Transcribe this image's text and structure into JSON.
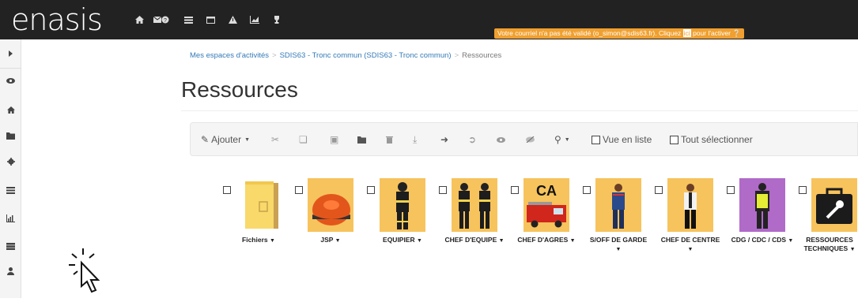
{
  "app": {
    "logo": "enasis",
    "notice": "Votre courriel n'a pas été validé (o_simon@sdis63.fr). Cliquez ",
    "notice_link": "ici",
    "notice_tail": " pour l'activer"
  },
  "topnav": {
    "icons": [
      "home-icon",
      "mail-icon",
      "messages-badge-icon",
      "list-icon",
      "window-icon",
      "warning-icon",
      "area-chart-icon",
      "trophy-icon"
    ]
  },
  "rail": {
    "icons": [
      "caret-right-icon",
      "eye-icon",
      "home-icon",
      "folder-icon",
      "gear-icon",
      "list-icon",
      "bar-chart-icon",
      "server-icon",
      "user-icon"
    ]
  },
  "breadcrumb": {
    "items": [
      "Mes espaces d'activités",
      "SDIS63 - Tronc commun (SDIS63 - Tronc commun)",
      "Ressources"
    ]
  },
  "page": {
    "title": "Ressources"
  },
  "toolbar": {
    "add_label": "Ajouter",
    "list_view_label": "Vue en liste",
    "select_all_label": "Tout sélectionner"
  },
  "tiles": [
    {
      "label": "Fichiers",
      "dropdown": true
    },
    {
      "label": "JSP",
      "dropdown": true
    },
    {
      "label": "EQUIPIER",
      "dropdown": true
    },
    {
      "label": "CHEF D'EQUIPE",
      "dropdown": true
    },
    {
      "label": "CHEF D'AGRES",
      "dropdown": true,
      "badge": "CA"
    },
    {
      "label": "S/OFF DE GARDE",
      "dropdown": true
    },
    {
      "label": "CHEF DE CENTRE",
      "dropdown": true
    },
    {
      "label": "CDG / CDC / CDS",
      "dropdown": true
    },
    {
      "label": "RESSOURCES TECHNIQUES",
      "dropdown": true
    }
  ],
  "colors": {
    "navbar": "#222222",
    "notice": "#f0a030",
    "link": "#337ab7",
    "tile_bg": "#f7c35d",
    "tile_bg_purple": "#b06ac8"
  }
}
